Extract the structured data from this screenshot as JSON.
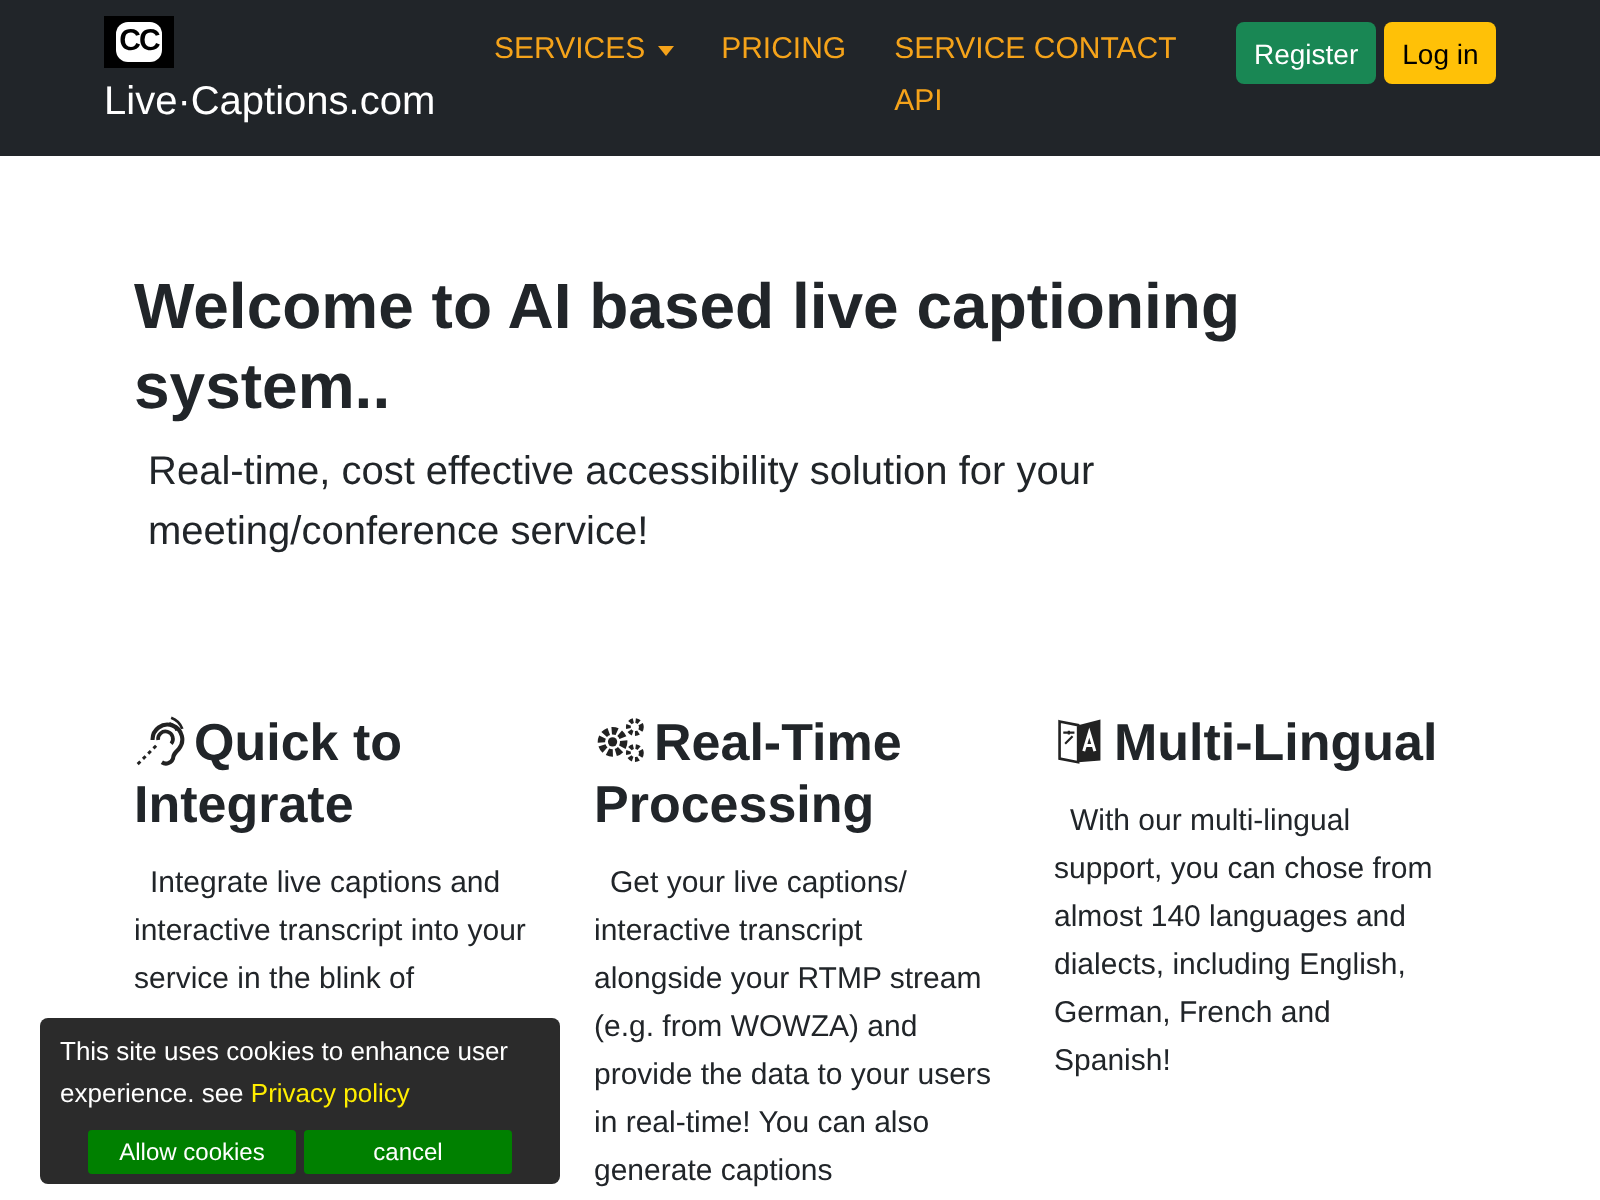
{
  "header": {
    "logo_text": "CC",
    "brand": "Live·Captions.com",
    "nav": [
      {
        "label": "SERVICES",
        "dropdown": true
      },
      {
        "label": "PRICING",
        "dropdown": false
      },
      {
        "label": "SERVICE CONTACT API",
        "dropdown": false
      }
    ],
    "buttons": [
      {
        "label": "Register",
        "kind": "success"
      },
      {
        "label": "Log in",
        "kind": "warning"
      }
    ]
  },
  "hero": {
    "title": "Welcome to AI based live captioning system..",
    "subtitle": "Real-time, cost effective accessibility solution for your meeting/conference service!"
  },
  "features": [
    {
      "kind": "hearing",
      "title": "Quick to Integrate",
      "text": "Integrate live captions and interactive transcript into your service in the blink of"
    },
    {
      "kind": "gears",
      "title": "Real-Time Processing",
      "text": "Get your live captions/ interactive transcript alongside your RTMP stream (e.g. from WOWZA) and provide the data to your users in real-time! You can also generate captions"
    },
    {
      "kind": "language",
      "title": "Multi-Lingual",
      "text": "With our multi-lingual support, you can chose from almost 140 languages and dialects, including English, German, French and Spanish!"
    }
  ],
  "cookie_banner": {
    "text": "This site uses cookies to enhance user experience. see",
    "link": "Privacy policy",
    "buttons": [
      "Allow cookies",
      "cancel"
    ]
  }
}
